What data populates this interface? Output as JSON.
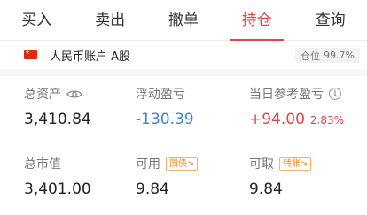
{
  "tabs": [
    {
      "label": "买入"
    },
    {
      "label": "卖出"
    },
    {
      "label": "撤单"
    },
    {
      "label": "持仓",
      "active": true
    },
    {
      "label": "查询"
    }
  ],
  "account": {
    "flag_icon": "china-flag-icon",
    "name": "人民币账户 A股",
    "position_label": "仓位",
    "position_value": "99.7%"
  },
  "stats": {
    "total_assets": {
      "label": "总资产",
      "value": "3,410.84"
    },
    "floating_pl": {
      "label": "浮动盈亏",
      "value": "-130.39"
    },
    "today_pl": {
      "label": "当日参考盈亏",
      "value": "+94.00",
      "percent": "2.83%"
    },
    "market_value": {
      "label": "总市值",
      "value": "3,401.00"
    },
    "available": {
      "label": "可用",
      "value": "9.84",
      "tag": "国债>"
    },
    "withdrawable": {
      "label": "可取",
      "value": "9.84",
      "tag": "转账>"
    }
  },
  "colors": {
    "accent": "#e8434a",
    "negative": "#3b86d6",
    "tag": "#f08a1d"
  }
}
